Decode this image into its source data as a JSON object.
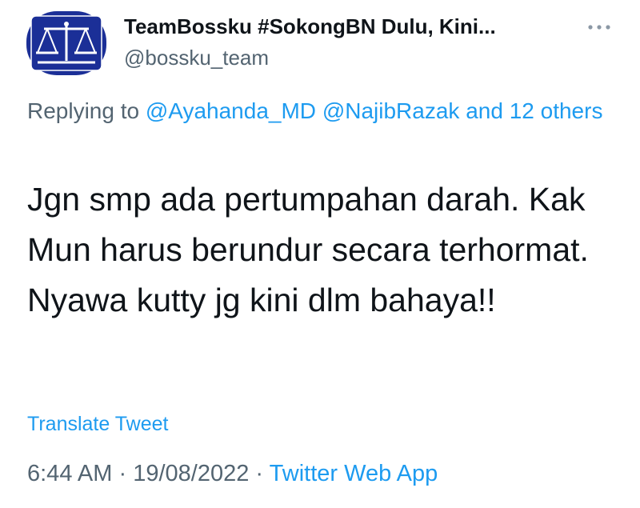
{
  "tweet": {
    "author": {
      "display_name": "TeamBossku #SokongBN Dulu, Kini...",
      "handle": "@bossku_team",
      "avatar_icon": "scales-of-justice-icon",
      "avatar_bg": "#1b2f97"
    },
    "more_icon": "ellipsis-icon",
    "replying": {
      "prefix": "Replying to",
      "mention1": "@Ayahanda_MD",
      "mention2": "@NajibRazak",
      "others": "and 12 others"
    },
    "text": "Jgn smp ada pertumpahan darah. Kak Mun harus berundur secara terhormat. Nyawa kutty jg kini dlm bahaya!!",
    "translate_label": "Translate Tweet",
    "meta": {
      "time": "6:44 AM",
      "separator": "·",
      "date": "19/08/2022",
      "source": "Twitter Web App"
    }
  },
  "colors": {
    "link": "#1d9bf0",
    "secondary_text": "#536471",
    "primary_text": "#0f1419"
  }
}
